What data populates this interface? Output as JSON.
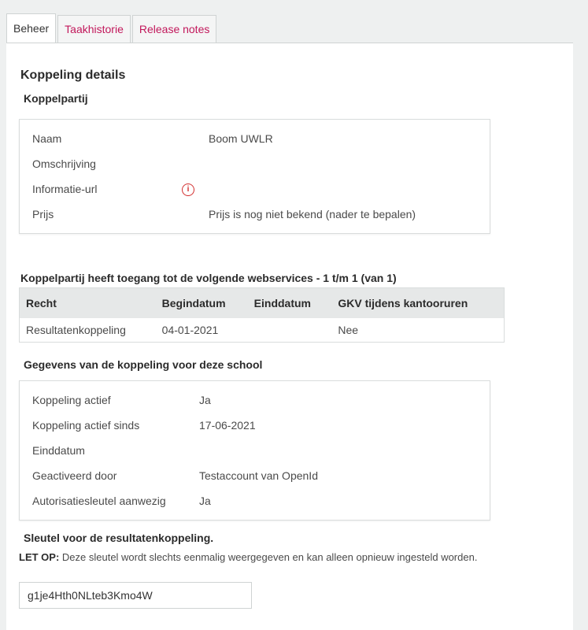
{
  "tabs": [
    {
      "label": "Beheer",
      "active": true
    },
    {
      "label": "Taakhistorie",
      "active": false
    },
    {
      "label": "Release notes",
      "active": false
    }
  ],
  "page_title": "Koppeling details",
  "koppelpartij": {
    "heading": "Koppelpartij",
    "rows": [
      {
        "key": "Naam",
        "value": "Boom UWLR"
      },
      {
        "key": "Omschrijving",
        "value": ""
      },
      {
        "key": "Informatie-url",
        "value": ""
      },
      {
        "key": "Prijs",
        "value": "Prijs is nog niet bekend (nader te bepalen)"
      }
    ],
    "info_icon": "info-circle-icon"
  },
  "webservices": {
    "heading": "Koppelpartij heeft toegang tot de volgende webservices - 1 t/m 1 (van 1)",
    "columns": [
      "Recht",
      "Begindatum",
      "Einddatum",
      "GKV tijdens kantooruren"
    ],
    "rows": [
      [
        "Resultatenkoppeling",
        "04-01-2021",
        "",
        "Nee"
      ]
    ]
  },
  "gegevens": {
    "heading": "Gegevens van de koppeling voor deze school",
    "rows": [
      {
        "key": "Koppeling actief",
        "value": "Ja"
      },
      {
        "key": "Koppeling actief sinds",
        "value": "17-06-2021"
      },
      {
        "key": "Einddatum",
        "value": ""
      },
      {
        "key": "Geactiveerd door",
        "value": "Testaccount van OpenId"
      },
      {
        "key": "Autorisatiesleutel aanwezig",
        "value": "Ja"
      }
    ]
  },
  "sleutel": {
    "heading": "Sleutel voor de resultatenkoppeling.",
    "note_prefix": "LET OP:",
    "note_text": " Deze sleutel wordt slechts eenmalig weergegeven en kan alleen opnieuw ingesteld worden.",
    "value": "g1je4Hth0NLteb3Kmo4W"
  },
  "colors": {
    "tab_link": "#c2185b",
    "info_icon": "#d32f2f",
    "background": "#eef0f0"
  }
}
